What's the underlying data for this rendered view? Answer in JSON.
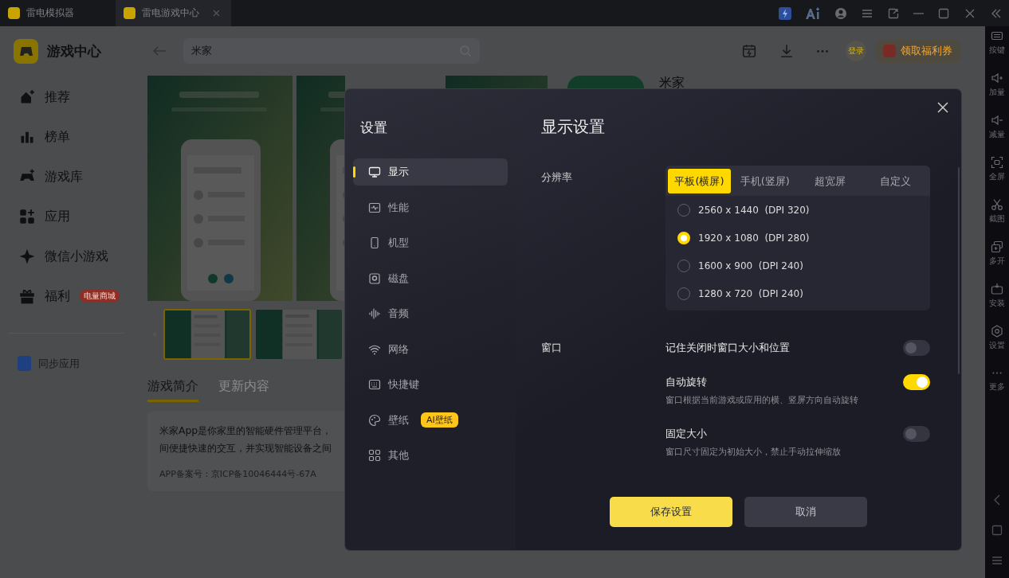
{
  "titlebar": {
    "tabs": [
      {
        "label": "雷电模拟器",
        "selected": false
      },
      {
        "label": "雷电游戏中心",
        "selected": true
      }
    ]
  },
  "sidebar": {
    "title": "游戏中心",
    "items": [
      {
        "label": "推荐"
      },
      {
        "label": "榜单"
      },
      {
        "label": "游戏库"
      },
      {
        "label": "应用"
      },
      {
        "label": "微信小游戏"
      },
      {
        "label": "福利",
        "badge": "电量商城"
      }
    ],
    "sync": "同步应用"
  },
  "search": {
    "value": "米家"
  },
  "header": {
    "login": "登录",
    "welfare": "领取福利券"
  },
  "app": {
    "name": "米家"
  },
  "thumbnails": [
    {
      "selected": true
    },
    {
      "selected": false
    }
  ],
  "detail_tabs": [
    {
      "label": "游戏简介",
      "selected": true
    },
    {
      "label": "更新内容",
      "selected": false
    }
  ],
  "description": {
    "lines": [
      "米家App是你家里的智能硬件管理平台，",
      "间便捷快速的交互，并实现智能设备之间"
    ],
    "record": "APP备案号：京ICP备10046444号-67A"
  },
  "toolbar": [
    "按键",
    "加量",
    "减量",
    "全屏",
    "截图",
    "多开",
    "安装",
    "设置",
    "更多"
  ],
  "dialog": {
    "title": "设置",
    "nav": [
      {
        "label": "显示",
        "selected": true
      },
      {
        "label": "性能",
        "selected": false
      },
      {
        "label": "机型",
        "selected": false
      },
      {
        "label": "磁盘",
        "selected": false
      },
      {
        "label": "音频",
        "selected": false
      },
      {
        "label": "网络",
        "selected": false
      },
      {
        "label": "快捷键",
        "selected": false
      },
      {
        "label": "壁纸",
        "selected": false,
        "badge": "AI壁纸"
      },
      {
        "label": "其他",
        "selected": false
      }
    ],
    "heading": "显示设置",
    "resolution": {
      "label": "分辨率",
      "tabs": [
        {
          "label": "平板(横屏)",
          "selected": true
        },
        {
          "label": "手机(竖屏)",
          "selected": false
        },
        {
          "label": "超宽屏",
          "selected": false
        },
        {
          "label": "自定义",
          "selected": false
        }
      ],
      "options": [
        {
          "label": "2560 x 1440  (DPI 320)",
          "selected": false
        },
        {
          "label": "1920 x 1080  (DPI 280)",
          "selected": true
        },
        {
          "label": "1600 x 900  (DPI 240)",
          "selected": false
        },
        {
          "label": "1280 x 720  (DPI 240)",
          "selected": false
        }
      ]
    },
    "window": {
      "label": "窗口",
      "toggles": [
        {
          "label": "记住关闭时窗口大小和位置",
          "on": false
        },
        {
          "label": "自动旋转",
          "on": true,
          "description": "窗口根据当前游戏或应用的横、竖屏方向自动旋转"
        },
        {
          "label": "固定大小",
          "on": false,
          "description": "窗口尺寸固定为初始大小，禁止手动拉伸缩放"
        }
      ]
    },
    "buttons": [
      {
        "label": "保存设置",
        "kind": "primary"
      },
      {
        "label": "取消",
        "kind": "secondary"
      }
    ]
  }
}
